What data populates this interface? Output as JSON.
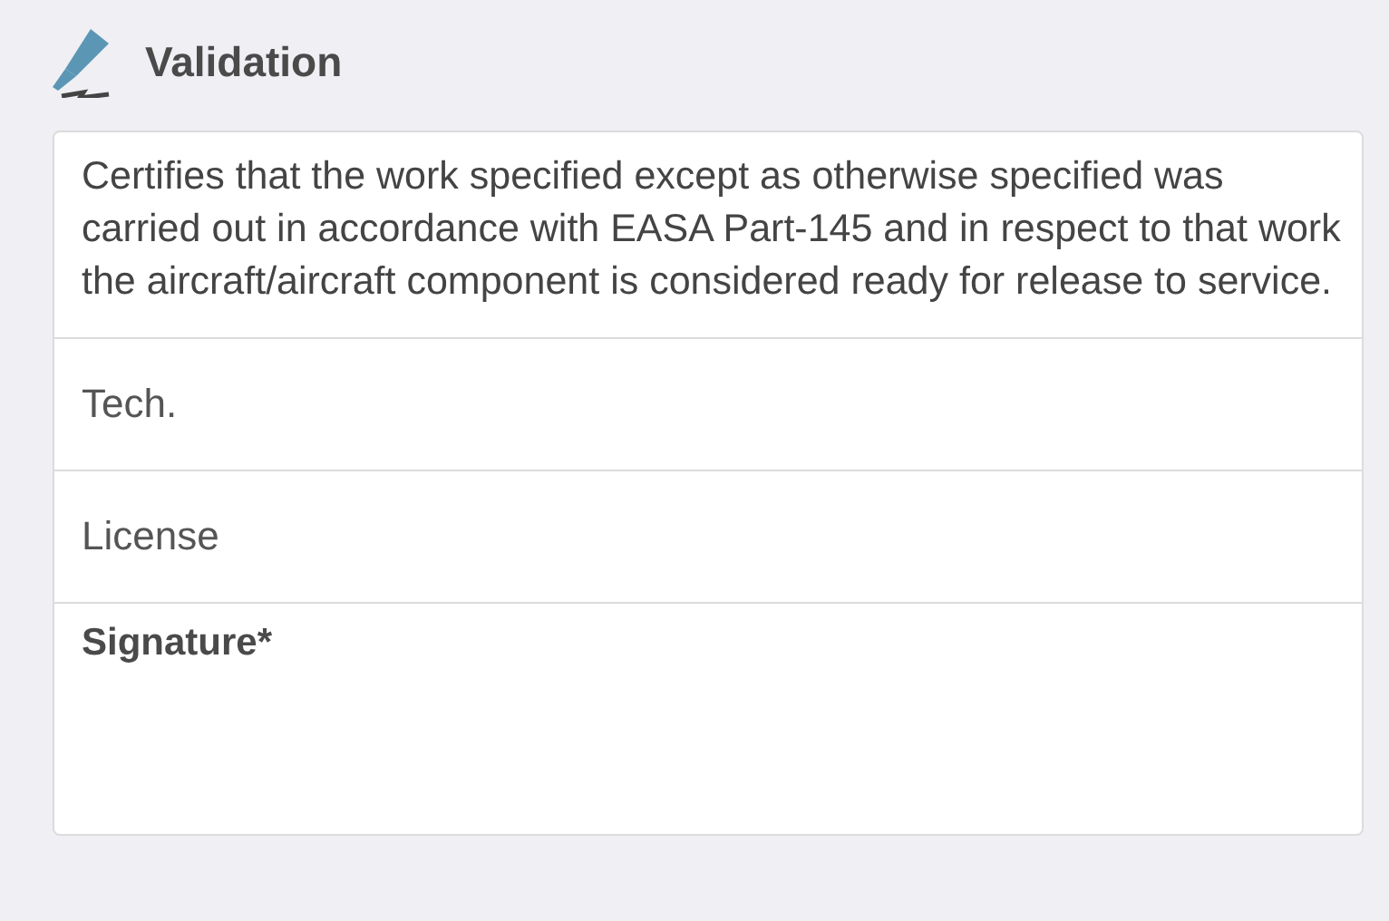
{
  "section": {
    "title": "Validation"
  },
  "statement": "Certifies that the work specified except as otherwise specified was carried out in accordance with EASA Part-145 and in respect to that work the aircraft/aircraft component is considered ready for release to service.",
  "fields": [
    {
      "placeholder": "Tech."
    },
    {
      "placeholder": "License"
    }
  ],
  "signature": {
    "label": "Signature*"
  }
}
